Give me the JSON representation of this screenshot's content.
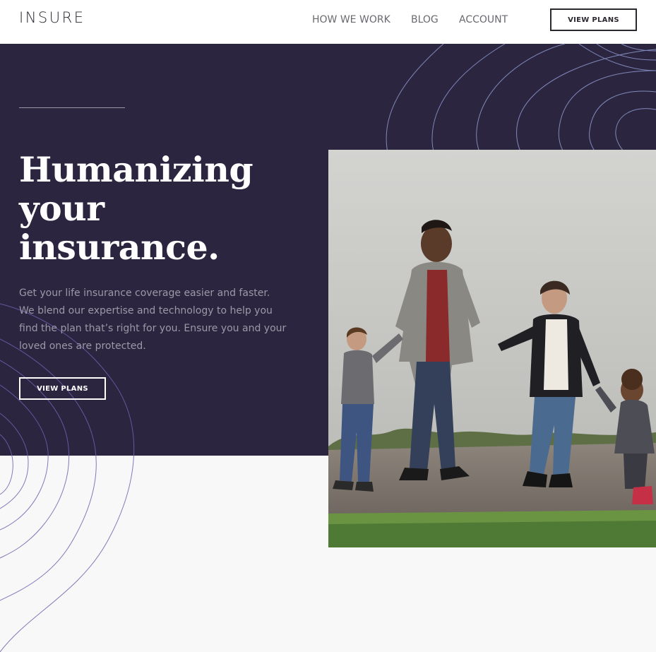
{
  "header": {
    "logo": "INSURE",
    "nav": {
      "how_we_work": "HOW WE WORK",
      "blog": "BLOG",
      "account": "ACCOUNT"
    },
    "cta_label": "VIEW PLANS"
  },
  "hero": {
    "title_line1": "Humanizing",
    "title_line2": "your",
    "title_line3": "insurance.",
    "description": "Get your life insurance coverage easier and faster. We blend our expertise and technology to help you find the plan that’s right for you. Ensure you and your loved ones are protected.",
    "cta_label": "VIEW PLANS"
  },
  "colors": {
    "hero_bg": "#2c2540",
    "page_bg": "#f8f8f8",
    "header_bg": "#ffffff",
    "logo": "#2c2830",
    "pattern_stroke_light": "#7b8bc4",
    "pattern_stroke_dark": "#5a56a0"
  },
  "icons": {
    "photo": "family-walking-photo",
    "pattern": "wavy-curves-pattern"
  }
}
